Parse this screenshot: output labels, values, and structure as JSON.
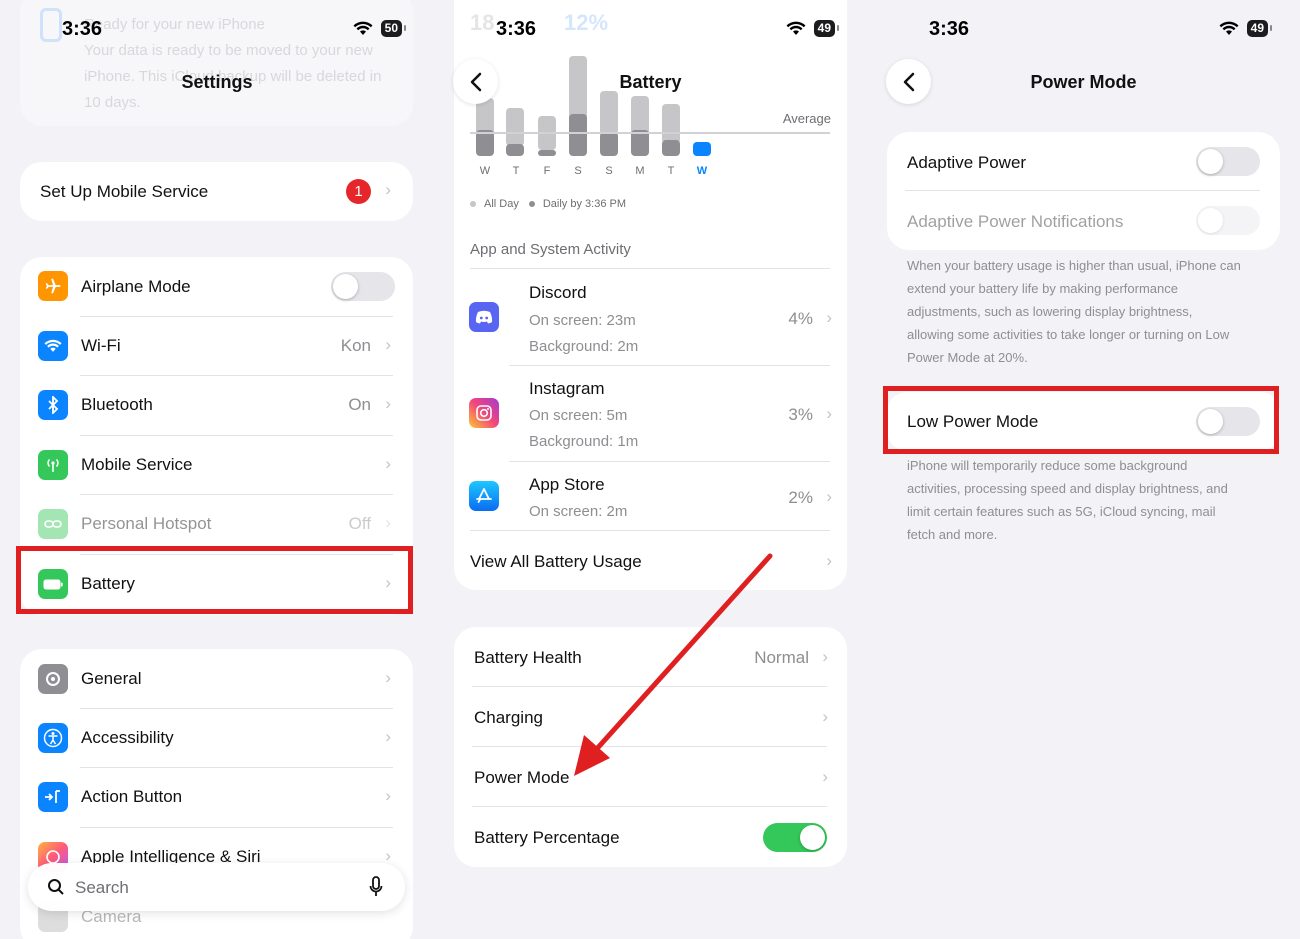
{
  "status": {
    "time": "3:36",
    "battery_p1": "50",
    "battery_p2": "49",
    "battery_p3": "49"
  },
  "settings": {
    "title": "Settings",
    "ghost_notice": [
      "Ready for your new iPhone",
      "Your data is ready to be moved to your new",
      "iPhone. This iCloud backup will be deleted in",
      "10 days."
    ],
    "setup": {
      "label": "Set Up Mobile Service",
      "badge": "1"
    },
    "group1": [
      {
        "label": "Airplane Mode",
        "value": "",
        "icon": "airplane-icon",
        "color": "#ff9500"
      },
      {
        "label": "Wi-Fi",
        "value": "Kon",
        "icon": "wifi-icon",
        "color": "#0a84ff"
      },
      {
        "label": "Bluetooth",
        "value": "On",
        "icon": "bluetooth-icon",
        "color": "#0a84ff"
      },
      {
        "label": "Mobile Service",
        "value": "",
        "icon": "antenna-icon",
        "color": "#34c759"
      },
      {
        "label": "Personal Hotspot",
        "value": "Off",
        "icon": "hotspot-icon",
        "color": "#34c759"
      },
      {
        "label": "Battery",
        "value": "",
        "icon": "battery-icon",
        "color": "#34c759"
      }
    ],
    "group2": [
      {
        "label": "General",
        "icon": "gear-icon",
        "color": "#8e8e93"
      },
      {
        "label": "Accessibility",
        "icon": "accessibility-icon",
        "color": "#0a84ff"
      },
      {
        "label": "Action Button",
        "icon": "action-button-icon",
        "color": "#0a84ff"
      },
      {
        "label": "Apple Intelligence & Siri",
        "icon": "siri-icon",
        "color": "#ff6b6b"
      },
      {
        "label": "Camera",
        "icon": "camera-icon",
        "color": "#8e8e93"
      }
    ],
    "search_placeholder": "Search"
  },
  "battery": {
    "title": "Battery",
    "ghost_top": [
      "18",
      "12%"
    ],
    "average_label": "Average",
    "days": [
      "W",
      "T",
      "F",
      "S",
      "S",
      "M",
      "T",
      "W"
    ],
    "legend": [
      "All Day",
      "Daily by 3:36 PM"
    ],
    "section_header": "App and System Activity",
    "apps": [
      {
        "name": "Discord",
        "on_screen": "On screen: 23m",
        "background": "Background: 2m",
        "pct": "4%",
        "icon": "discord-icon"
      },
      {
        "name": "Instagram",
        "on_screen": "On screen: 5m",
        "background": "Background: 1m",
        "pct": "3%",
        "icon": "instagram-icon"
      },
      {
        "name": "App Store",
        "on_screen": "On screen: 2m",
        "background": "",
        "pct": "2%",
        "icon": "app-store-icon"
      }
    ],
    "view_all": "View All Battery Usage",
    "group2": [
      {
        "label": "Battery Health",
        "value": "Normal"
      },
      {
        "label": "Charging",
        "value": ""
      },
      {
        "label": "Power Mode",
        "value": ""
      },
      {
        "label": "Battery Percentage",
        "value": ""
      }
    ]
  },
  "power": {
    "title": "Power Mode",
    "adaptive_power": "Adaptive Power",
    "adaptive_notif": "Adaptive Power Notifications",
    "footer1": [
      "When your battery usage is higher than usual, iPhone can",
      "extend your battery life by making performance",
      "adjustments, such as lowering display brightness,",
      "allowing some activities to take longer or turning on Low",
      "Power Mode at 20%."
    ],
    "low_power": "Low Power Mode",
    "footer2": [
      "iPhone will temporarily reduce some background",
      "activities, processing speed and display brightness, and",
      "limit certain features such as 5G, iCloud syncing, mail",
      "fetch and more."
    ]
  }
}
